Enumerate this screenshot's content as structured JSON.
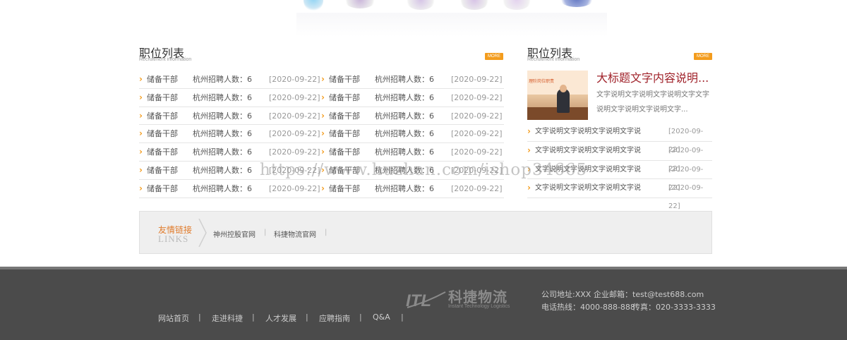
{
  "recruit_section": {
    "title": "职位列表",
    "subtitle": "Recruitment information",
    "more_label": "MORE"
  },
  "jobs_left": [
    {
      "title": "储备干部",
      "info": "杭州招聘人数：6",
      "date": "[2020-09-22]"
    },
    {
      "title": "储备干部",
      "info": "杭州招聘人数：6",
      "date": "[2020-09-22]"
    },
    {
      "title": "储备干部",
      "info": "杭州招聘人数：6",
      "date": "[2020-09-22]"
    },
    {
      "title": "储备干部",
      "info": "杭州招聘人数：6",
      "date": "[2020-09-22]"
    },
    {
      "title": "储备干部",
      "info": "杭州招聘人数：6",
      "date": "[2020-09-22]"
    },
    {
      "title": "储备干部",
      "info": "杭州招聘人数：6",
      "date": "[2020-09-22]"
    },
    {
      "title": "储备干部",
      "info": "杭州招聘人数：6",
      "date": "[2020-09-22]"
    }
  ],
  "jobs_right": [
    {
      "title": "储备干部",
      "info": "杭州招聘人数：6",
      "date": "[2020-09-22]"
    },
    {
      "title": "储备干部",
      "info": "杭州招聘人数：6",
      "date": "[2020-09-22]"
    },
    {
      "title": "储备干部",
      "info": "杭州招聘人数：6",
      "date": "[2020-09-22]"
    },
    {
      "title": "储备干部",
      "info": "杭州招聘人数：6",
      "date": "[2020-09-22]"
    },
    {
      "title": "储备干部",
      "info": "杭州招聘人数：6",
      "date": "[2020-09-22]"
    },
    {
      "title": "储备干部",
      "info": "杭州招聘人数：6",
      "date": "[2020-09-22]"
    },
    {
      "title": "储备干部",
      "info": "杭州招聘人数：6",
      "date": "[2020-09-22]"
    }
  ],
  "news_section": {
    "title": "职位列表",
    "subtitle": "Recruitment information",
    "more_label": "MORE",
    "feature_image_caption": "理阶岗位职责",
    "feature_title": "大标题文字内容说明...",
    "feature_desc": "文字说明文字说明文字说明文字文字说明文字说明文字说明文字...",
    "items": [
      {
        "text": "文字说明文字说明文字说明文字说",
        "date": "[2020-09-22]"
      },
      {
        "text": "文字说明文字说明文字说明文字说",
        "date": "[2020-09-22]"
      },
      {
        "text": "文字说明文字说明文字说明文字说",
        "date": "[2020-09-22]"
      },
      {
        "text": "文字说明文字说明文字说明文字说",
        "date": "[2020-09-22]"
      }
    ]
  },
  "links": {
    "title_cn": "友情链接",
    "title_en": "LINKS",
    "items": [
      "神州控股官网",
      "科捷物流官网"
    ]
  },
  "watermark": "https://www.huzhan.com/ishop34665",
  "footer": {
    "nav": [
      "网站首页",
      "走进科捷",
      "人才发展",
      "应聘指南",
      "Q&A"
    ],
    "logo_cn": "科捷物流",
    "logo_en": "Instant Technology Logistics",
    "address": "公司地址:XXX",
    "email": "企业邮箱：test@test688.com",
    "phone": "电话热线：4000-888-888",
    "fax": "传真：020-3333-3333"
  },
  "colors": {
    "accent": "#f39c1d",
    "feature_title": "#a0222a",
    "footer_bg": "#4b4b4b"
  }
}
